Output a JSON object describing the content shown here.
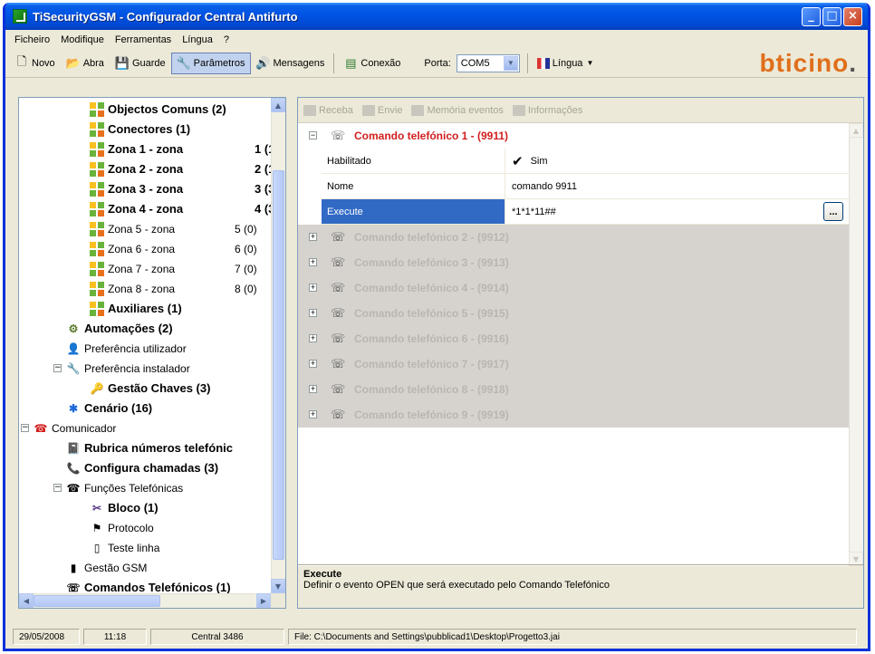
{
  "window": {
    "title": "TiSecurityGSM - Configurador Central Antifurto"
  },
  "menu": [
    "Ficheiro",
    "Modifique",
    "Ferramentas",
    "Língua",
    "?"
  ],
  "toolbar": {
    "novo": "Novo",
    "abra": "Abra",
    "guarde": "Guarde",
    "parametros": "Parâmetros",
    "mensagens": "Mensagens",
    "conexao": "Conexão",
    "porta_label": "Porta:",
    "porta_value": "COM5",
    "lingua": "Língua",
    "brand": "bticino",
    "brand_suffix": "."
  },
  "tree": {
    "objectos_comuns": "Objectos Comuns (2)",
    "conectores": "Conectores (1)",
    "zones": [
      {
        "label": "Zona 1 - zona",
        "count": "1 (1"
      },
      {
        "label": "Zona 2 - zona",
        "count": "2 (1"
      },
      {
        "label": "Zona 3 - zona",
        "count": "3 (3"
      },
      {
        "label": "Zona 4 - zona",
        "count": "4 (3"
      },
      {
        "label": "Zona 5 - zona",
        "count": "5 (0)"
      },
      {
        "label": "Zona 6 - zona",
        "count": "6 (0)"
      },
      {
        "label": "Zona 7 - zona",
        "count": "7 (0)"
      },
      {
        "label": "Zona 8 - zona",
        "count": "8 (0)"
      }
    ],
    "auxiliares": "Auxiliares (1)",
    "automacoes": "Automações (2)",
    "pref_utilizador": "Preferência utilizador",
    "pref_instalador": "Preferência instalador",
    "gestao_chaves": "Gestão Chaves (3)",
    "cenario": "Cenário (16)",
    "comunicador": "Comunicador",
    "rubrica": "Rubrica números telefónic",
    "configura": "Configura chamadas (3)",
    "funcoes": "Funções Telefónicas",
    "bloco": "Bloco (1)",
    "protocolo": "Protocolo",
    "teste": "Teste linha",
    "gestao_gsm": "Gestão GSM",
    "comandos": "Comandos Telefónicos (1)"
  },
  "right_toolbar": {
    "receba": "Receba",
    "envie": "Envie",
    "memoria": "Memória eventos",
    "informacoes": "Informações"
  },
  "grid": {
    "open_category": "Comando telefónico 1 - (9911)",
    "props": {
      "habilitado_label": "Habilitado",
      "habilitado_value": "Sim",
      "nome_label": "Nome",
      "nome_value": "comando 9911",
      "execute_label": "Execute",
      "execute_value": "*1*1*11##",
      "ellipsis": "..."
    },
    "collapsed": [
      "Comando telefónico 2 - (9912)",
      "Comando telefónico 3 - (9913)",
      "Comando telefónico 4 - (9914)",
      "Comando telefónico 5 - (9915)",
      "Comando telefónico 6 - (9916)",
      "Comando telefónico 7 - (9917)",
      "Comando telefónico 8 - (9918)",
      "Comando telefónico 9 - (9919)"
    ]
  },
  "help": {
    "title": "Execute",
    "text": "Definir o evento OPEN que será executado pelo Comando Telefónico"
  },
  "status": {
    "date": "29/05/2008",
    "time": "11:18",
    "central": "Central 3486",
    "file": "File: C:\\Documents and Settings\\pubblicad1\\Desktop\\Progetto3.jai"
  }
}
